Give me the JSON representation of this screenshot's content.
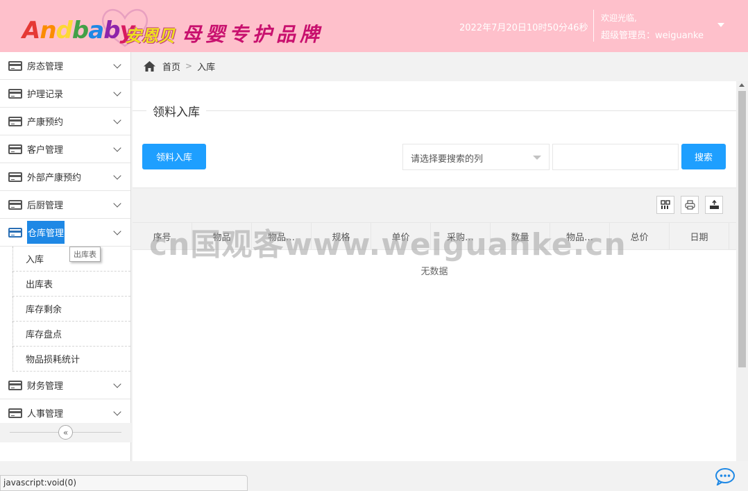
{
  "brand": {
    "logo_text": "Andbaby",
    "logo_cn": "安恩贝",
    "slogan": "母婴专护品牌"
  },
  "header": {
    "datetime": "2022年7月20日10时50分46秒",
    "welcome": "欢迎光临,",
    "admin": "超级管理员：weiguanke"
  },
  "sidebar": {
    "items": [
      {
        "label": "房态管理"
      },
      {
        "label": "护理记录"
      },
      {
        "label": "产康预约"
      },
      {
        "label": "客户管理"
      },
      {
        "label": "外部产康预约"
      },
      {
        "label": "后厨管理"
      },
      {
        "label": "仓库管理"
      },
      {
        "label": "财务管理"
      },
      {
        "label": "人事管理"
      }
    ],
    "submenu": [
      {
        "label": "入库"
      },
      {
        "label": "出库表"
      },
      {
        "label": "库存剩余"
      },
      {
        "label": "库存盘点"
      },
      {
        "label": "物品损耗统计"
      }
    ],
    "tooltip": "出库表",
    "collapse_icon": "«"
  },
  "breadcrumb": {
    "home": "首页",
    "sep": ">",
    "current": "入库"
  },
  "main": {
    "title": "领料入库",
    "add_button": "领料入库",
    "select_placeholder": "请选择要搜索的列",
    "search_value": "",
    "search_button": "搜索",
    "columns": [
      "序号",
      "物品",
      "物品…",
      "规格",
      "单价",
      "采购…",
      "数量",
      "物品…",
      "总价",
      "日期"
    ],
    "empty_text": "无数据"
  },
  "watermark": "cn国观客www.weiguanke.cn",
  "statusbar": "javascript:void(0)",
  "colors": {
    "header_bg": "#fec0cb",
    "primary": "#1e9fff",
    "active_menu": "#1e88e5"
  }
}
